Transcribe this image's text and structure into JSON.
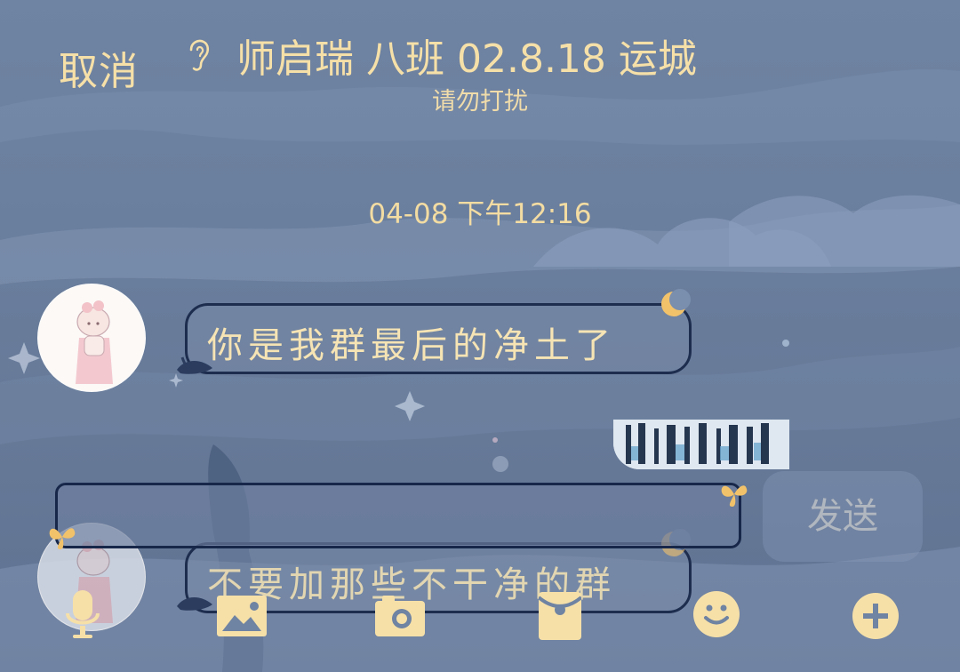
{
  "header": {
    "cancel_label": "取消",
    "title": "师启瑞 八班 02.8.18 运城",
    "subtitle": "请勿打扰",
    "icon": "ear-icon"
  },
  "chat": {
    "timestamp": "04-08 下午12:16",
    "messages": [
      {
        "text": "你是我群最后的净土了",
        "side": "left"
      },
      {
        "text": "不要加那些不干净的群",
        "side": "left"
      }
    ]
  },
  "composer": {
    "input_value": "",
    "send_label": "发送"
  },
  "toolbar": {
    "icons": [
      "microphone-icon",
      "image-icon",
      "camera-icon",
      "red-packet-icon",
      "emoji-icon",
      "plus-icon"
    ]
  },
  "colors": {
    "accent": "#f6e0a8",
    "background": "#6f83a2",
    "bubble_border": "#1d2d4e"
  }
}
